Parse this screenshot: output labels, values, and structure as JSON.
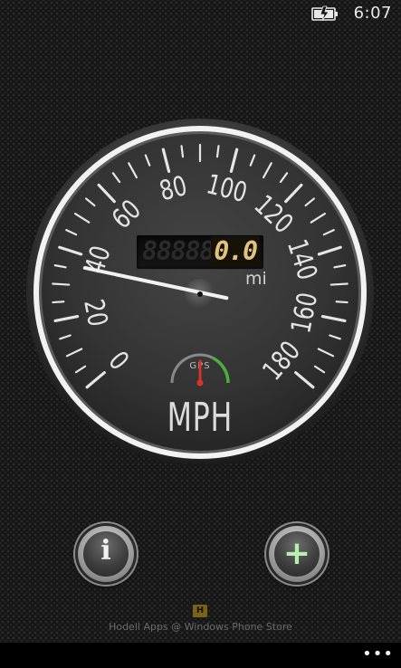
{
  "status_bar": {
    "battery_icon": "battery-charging-icon",
    "time": "6:07"
  },
  "speedometer": {
    "speed_labels": [
      "0",
      "20",
      "40",
      "60",
      "80",
      "100",
      "120",
      "140",
      "160",
      "180"
    ],
    "current_speed": 36,
    "max_speed": 180,
    "odometer_ghost": "88888",
    "odometer_value": "0.0",
    "odometer_unit": "mi",
    "gps_label": "GPS",
    "gps_signal_level": 0.5,
    "unit_label": "MPH",
    "colors": {
      "needle": "#f2f2f2",
      "odometer_digits": "#e3c27c",
      "gps_red": "#d8332a",
      "gps_green": "#4caf3a"
    }
  },
  "buttons": {
    "info_glyph": "i",
    "add_glyph": "+"
  },
  "footer": {
    "store_logo_letter": "H",
    "store_text": "Hodell Apps @ Windows Phone Store"
  },
  "app_bar": {
    "more_label": "•••"
  }
}
